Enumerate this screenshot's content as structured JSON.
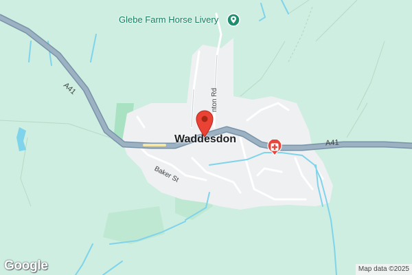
{
  "map": {
    "town_label": "Waddesdon",
    "poi_label": "Glebe Farm Horse Livery",
    "road_labels": {
      "a41_left": "A41",
      "a41_right": "A41",
      "baker_st": "Baker St",
      "nton_rd": "nton Rd"
    },
    "logo_text": "Google",
    "attribution": "Map data ©2025",
    "icons": {
      "marker": "red-location-pin",
      "poi": "green-horse-livery-pin",
      "hospital": "red-medical-cross-pin"
    },
    "colors": {
      "land": "#cdeee0",
      "urban": "#eef0f2",
      "main_road": "#8ea3b5",
      "water": "#7fd3ea",
      "marker": "#ea4335",
      "poi": "#1e8e6e"
    }
  }
}
